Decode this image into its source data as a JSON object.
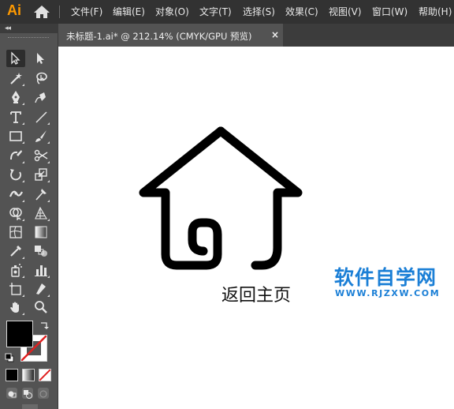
{
  "app": {
    "logo": "Ai"
  },
  "menu": [
    "文件(F)",
    "编辑(E)",
    "对象(O)",
    "文字(T)",
    "选择(S)",
    "效果(C)",
    "视图(V)",
    "窗口(W)",
    "帮助(H)"
  ],
  "document_tab": {
    "title": "未标题-1.ai* @ 212.14% (CMYK/GPU 预览)",
    "close": "×"
  },
  "panel": {
    "collapse": "◂◂"
  },
  "tools": [
    "selection-tool",
    "direct-selection-tool",
    "magic-wand-tool",
    "lasso-tool",
    "pen-tool",
    "curvature-tool",
    "type-tool",
    "line-segment-tool",
    "rectangle-tool",
    "paintbrush-tool",
    "shaper-tool",
    "scissors-tool",
    "rotate-tool",
    "scale-tool",
    "width-tool",
    "puppet-warp-tool",
    "shape-builder-tool",
    "perspective-grid-tool",
    "mesh-tool",
    "gradient-tool",
    "eyedropper-tool",
    "blend-tool",
    "symbol-sprayer-tool",
    "column-graph-tool",
    "artboard-tool",
    "slice-tool",
    "hand-tool",
    "zoom-tool"
  ],
  "colors": {
    "fill": "#000000",
    "stroke": "none",
    "watermark": "#1b7fd6",
    "ui_dark": "#323232",
    "ui_mid": "#535353"
  },
  "canvas": {
    "artwork_label": "返回主页",
    "watermark_cn": "软件自学网",
    "watermark_en": "WWW.RJZXW.COM"
  }
}
